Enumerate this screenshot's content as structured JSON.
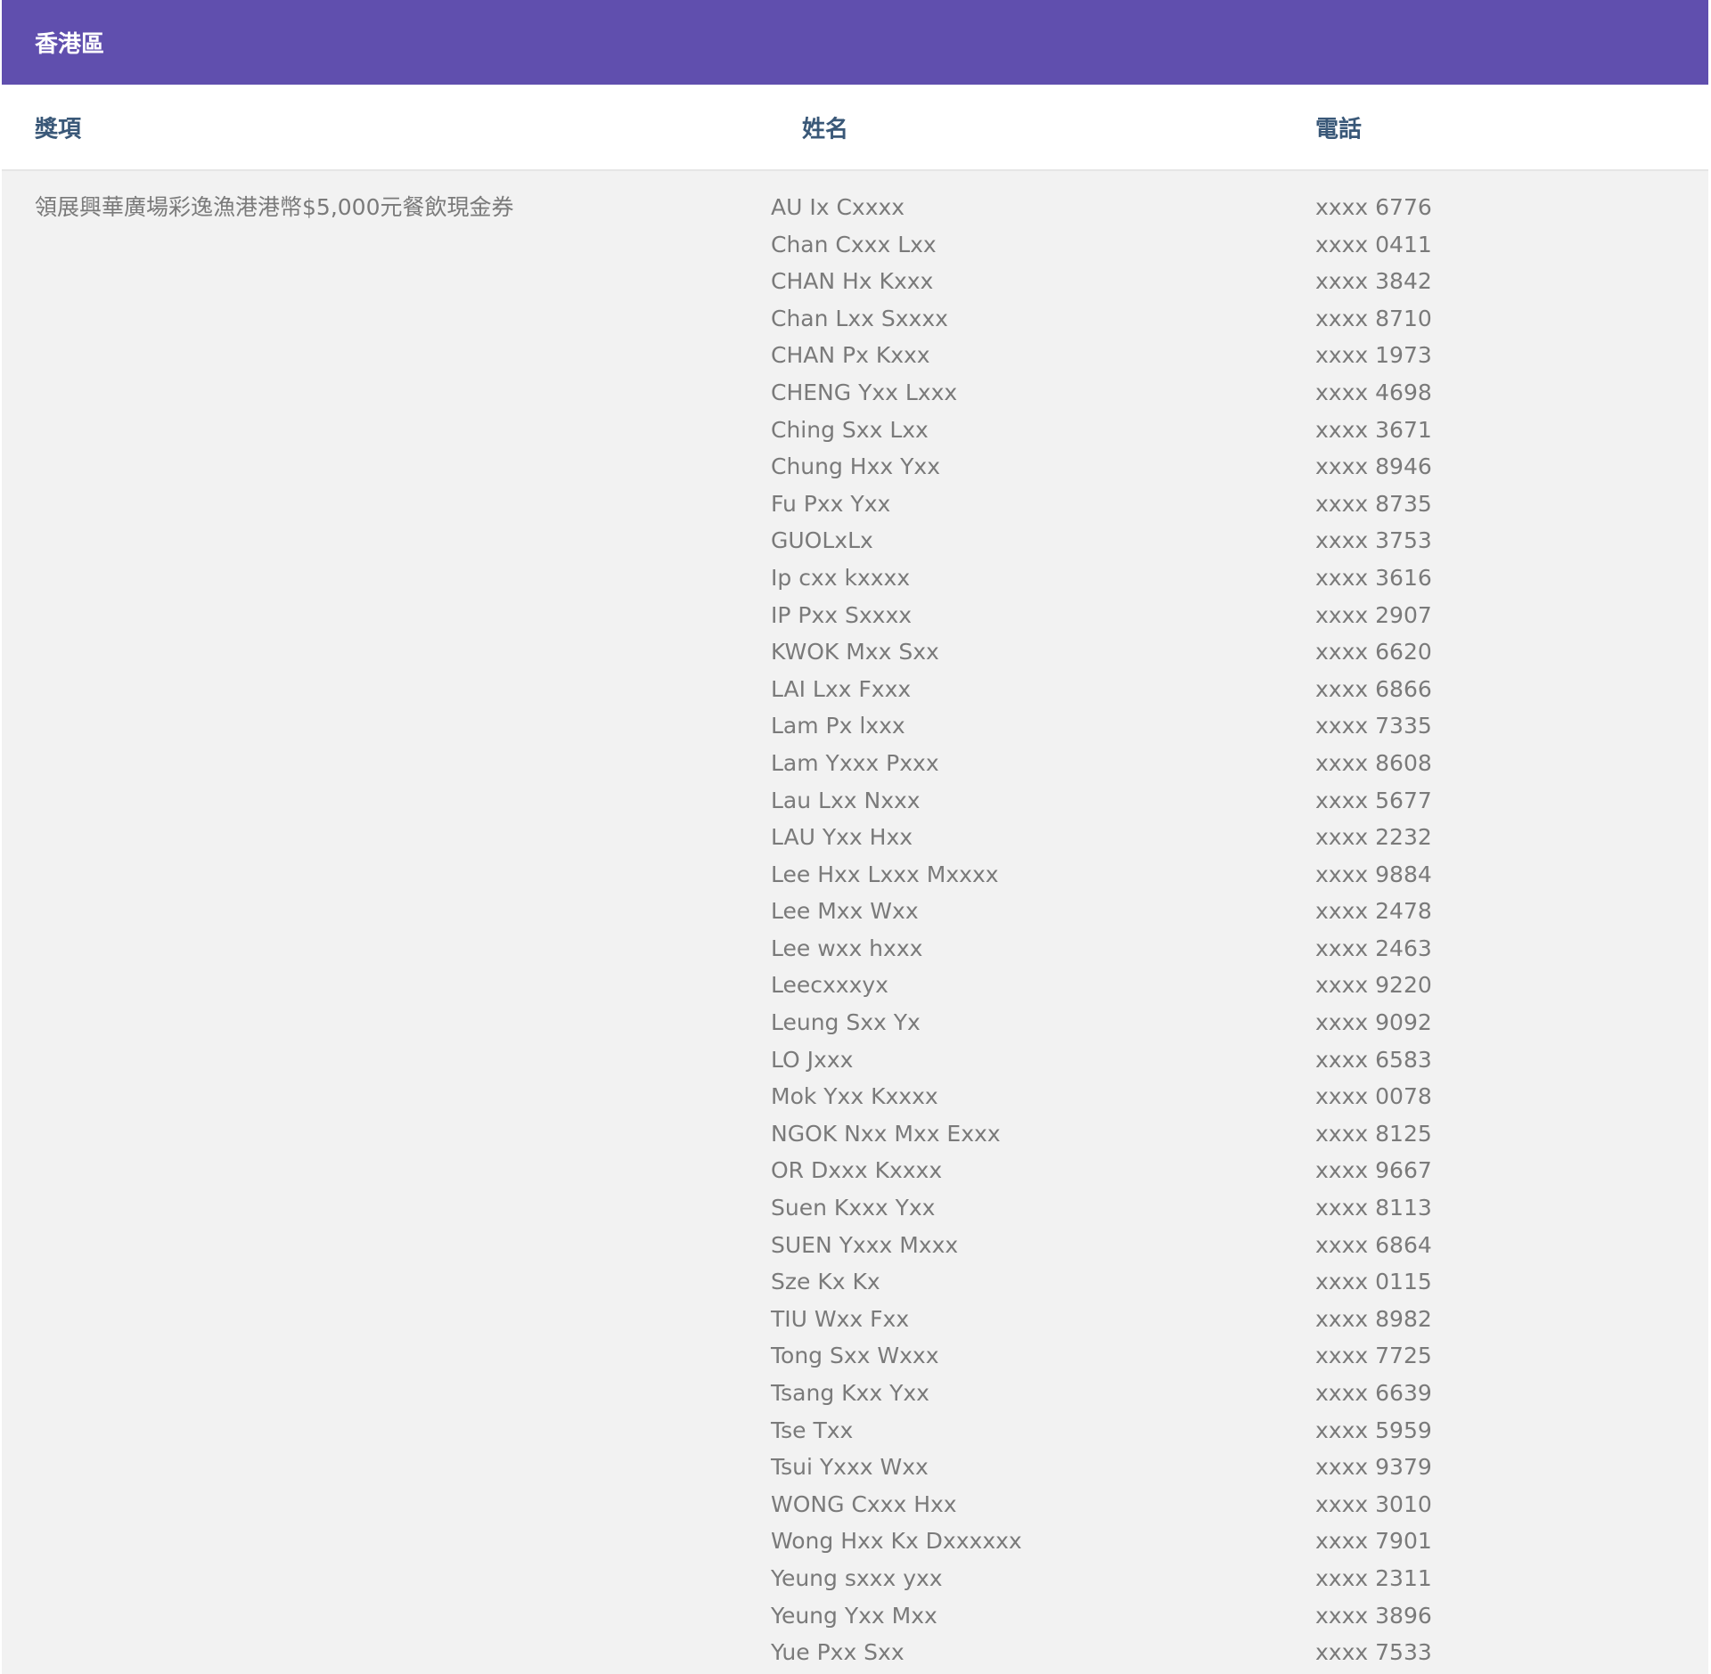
{
  "region": "香港區",
  "headers": {
    "prize": "獎項",
    "name": "姓名",
    "phone": "電話"
  },
  "prize": "領展興華廣場彩逸漁港港幣$5,000元餐飲現金券",
  "names": [
    "AU Ix Cxxxx",
    "Chan Cxxx Lxx",
    "CHAN Hx Kxxx",
    "Chan Lxx Sxxxx",
    "CHAN Px Kxxx",
    "CHENG Yxx Lxxx",
    "Ching Sxx Lxx",
    "Chung Hxx Yxx",
    "Fu Pxx Yxx",
    "GUOLxLx",
    "Ip cxx kxxxx",
    "IP Pxx Sxxxx",
    "KWOK Mxx Sxx",
    "LAI Lxx Fxxx",
    "Lam Px lxxx",
    "Lam Yxxx Pxxx",
    "Lau Lxx Nxxx",
    "LAU Yxx Hxx",
    "Lee Hxx Lxxx Mxxxx",
    "Lee Mxx Wxx",
    "Lee wxx hxxx",
    "Leecxxxyx",
    "Leung Sxx Yx",
    "LO Jxxx",
    "Mok Yxx Kxxxx",
    "NGOK Nxx Mxx Exxx",
    "OR Dxxx Kxxxx",
    "Suen Kxxx Yxx",
    "SUEN Yxxx Mxxx",
    "Sze Kx Kx",
    "TIU Wxx Fxx",
    "Tong Sxx Wxxx",
    "Tsang Kxx Yxx",
    "Tse Txx",
    "Tsui Yxxx Wxx",
    "WONG Cxxx Hxx",
    "Wong Hxx Kx Dxxxxxx",
    "Yeung sxxx yxx",
    "Yeung Yxx Mxx",
    "Yue Pxx Sxx"
  ],
  "phones": [
    "xxxx 6776",
    "xxxx 0411",
    "xxxx 3842",
    "xxxx 8710",
    "xxxx 1973",
    "xxxx 4698",
    "xxxx 3671",
    "xxxx 8946",
    "xxxx 8735",
    "xxxx 3753",
    "xxxx 3616",
    "xxxx 2907",
    "xxxx 6620",
    "xxxx 6866",
    "xxxx 7335",
    "xxxx 8608",
    "xxxx 5677",
    "xxxx 2232",
    "xxxx 9884",
    "xxxx 2478",
    "xxxx 2463",
    "xxxx 9220",
    "xxxx 9092",
    "xxxx 6583",
    "xxxx 0078",
    "xxxx 8125",
    "xxxx 9667",
    "xxxx 8113",
    "xxxx 6864",
    "xxxx 0115",
    "xxxx 8982",
    "xxxx 7725",
    "xxxx 6639",
    "xxxx 5959",
    "xxxx 9379",
    "xxxx 3010",
    "xxxx 7901",
    "xxxx 2311",
    "xxxx 3896",
    "xxxx 7533"
  ],
  "colors": {
    "header_bg": "#604fae",
    "header_text": "#ffffff",
    "column_header_text": "#3a5878",
    "body_text": "#7a7a7a",
    "body_bg": "#f2f2f2"
  }
}
